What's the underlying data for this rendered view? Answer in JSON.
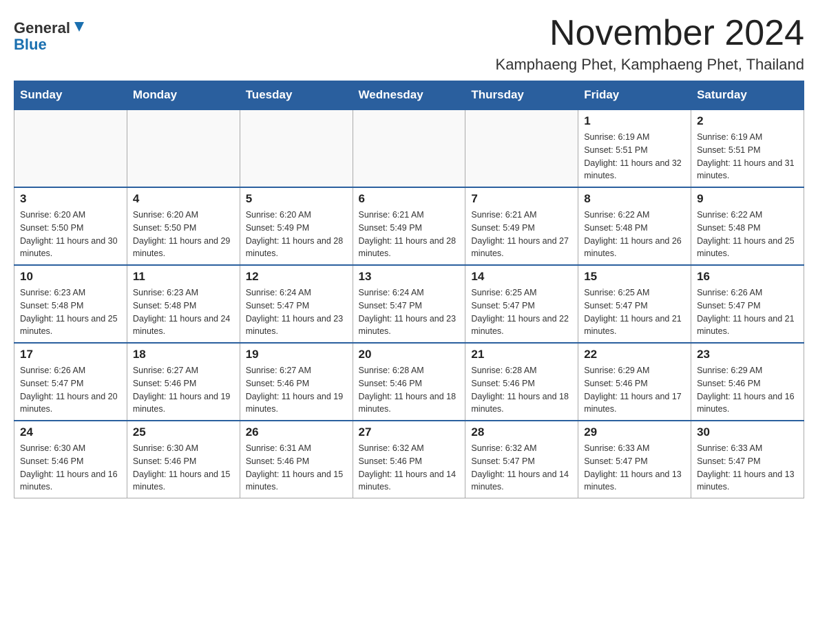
{
  "header": {
    "logo_general": "General",
    "logo_blue": "Blue",
    "month_year": "November 2024",
    "location": "Kamphaeng Phet, Kamphaeng Phet, Thailand"
  },
  "days_of_week": [
    "Sunday",
    "Monday",
    "Tuesday",
    "Wednesday",
    "Thursday",
    "Friday",
    "Saturday"
  ],
  "weeks": [
    [
      {
        "day": "",
        "info": ""
      },
      {
        "day": "",
        "info": ""
      },
      {
        "day": "",
        "info": ""
      },
      {
        "day": "",
        "info": ""
      },
      {
        "day": "",
        "info": ""
      },
      {
        "day": "1",
        "info": "Sunrise: 6:19 AM\nSunset: 5:51 PM\nDaylight: 11 hours and 32 minutes."
      },
      {
        "day": "2",
        "info": "Sunrise: 6:19 AM\nSunset: 5:51 PM\nDaylight: 11 hours and 31 minutes."
      }
    ],
    [
      {
        "day": "3",
        "info": "Sunrise: 6:20 AM\nSunset: 5:50 PM\nDaylight: 11 hours and 30 minutes."
      },
      {
        "day": "4",
        "info": "Sunrise: 6:20 AM\nSunset: 5:50 PM\nDaylight: 11 hours and 29 minutes."
      },
      {
        "day": "5",
        "info": "Sunrise: 6:20 AM\nSunset: 5:49 PM\nDaylight: 11 hours and 28 minutes."
      },
      {
        "day": "6",
        "info": "Sunrise: 6:21 AM\nSunset: 5:49 PM\nDaylight: 11 hours and 28 minutes."
      },
      {
        "day": "7",
        "info": "Sunrise: 6:21 AM\nSunset: 5:49 PM\nDaylight: 11 hours and 27 minutes."
      },
      {
        "day": "8",
        "info": "Sunrise: 6:22 AM\nSunset: 5:48 PM\nDaylight: 11 hours and 26 minutes."
      },
      {
        "day": "9",
        "info": "Sunrise: 6:22 AM\nSunset: 5:48 PM\nDaylight: 11 hours and 25 minutes."
      }
    ],
    [
      {
        "day": "10",
        "info": "Sunrise: 6:23 AM\nSunset: 5:48 PM\nDaylight: 11 hours and 25 minutes."
      },
      {
        "day": "11",
        "info": "Sunrise: 6:23 AM\nSunset: 5:48 PM\nDaylight: 11 hours and 24 minutes."
      },
      {
        "day": "12",
        "info": "Sunrise: 6:24 AM\nSunset: 5:47 PM\nDaylight: 11 hours and 23 minutes."
      },
      {
        "day": "13",
        "info": "Sunrise: 6:24 AM\nSunset: 5:47 PM\nDaylight: 11 hours and 23 minutes."
      },
      {
        "day": "14",
        "info": "Sunrise: 6:25 AM\nSunset: 5:47 PM\nDaylight: 11 hours and 22 minutes."
      },
      {
        "day": "15",
        "info": "Sunrise: 6:25 AM\nSunset: 5:47 PM\nDaylight: 11 hours and 21 minutes."
      },
      {
        "day": "16",
        "info": "Sunrise: 6:26 AM\nSunset: 5:47 PM\nDaylight: 11 hours and 21 minutes."
      }
    ],
    [
      {
        "day": "17",
        "info": "Sunrise: 6:26 AM\nSunset: 5:47 PM\nDaylight: 11 hours and 20 minutes."
      },
      {
        "day": "18",
        "info": "Sunrise: 6:27 AM\nSunset: 5:46 PM\nDaylight: 11 hours and 19 minutes."
      },
      {
        "day": "19",
        "info": "Sunrise: 6:27 AM\nSunset: 5:46 PM\nDaylight: 11 hours and 19 minutes."
      },
      {
        "day": "20",
        "info": "Sunrise: 6:28 AM\nSunset: 5:46 PM\nDaylight: 11 hours and 18 minutes."
      },
      {
        "day": "21",
        "info": "Sunrise: 6:28 AM\nSunset: 5:46 PM\nDaylight: 11 hours and 18 minutes."
      },
      {
        "day": "22",
        "info": "Sunrise: 6:29 AM\nSunset: 5:46 PM\nDaylight: 11 hours and 17 minutes."
      },
      {
        "day": "23",
        "info": "Sunrise: 6:29 AM\nSunset: 5:46 PM\nDaylight: 11 hours and 16 minutes."
      }
    ],
    [
      {
        "day": "24",
        "info": "Sunrise: 6:30 AM\nSunset: 5:46 PM\nDaylight: 11 hours and 16 minutes."
      },
      {
        "day": "25",
        "info": "Sunrise: 6:30 AM\nSunset: 5:46 PM\nDaylight: 11 hours and 15 minutes."
      },
      {
        "day": "26",
        "info": "Sunrise: 6:31 AM\nSunset: 5:46 PM\nDaylight: 11 hours and 15 minutes."
      },
      {
        "day": "27",
        "info": "Sunrise: 6:32 AM\nSunset: 5:46 PM\nDaylight: 11 hours and 14 minutes."
      },
      {
        "day": "28",
        "info": "Sunrise: 6:32 AM\nSunset: 5:47 PM\nDaylight: 11 hours and 14 minutes."
      },
      {
        "day": "29",
        "info": "Sunrise: 6:33 AM\nSunset: 5:47 PM\nDaylight: 11 hours and 13 minutes."
      },
      {
        "day": "30",
        "info": "Sunrise: 6:33 AM\nSunset: 5:47 PM\nDaylight: 11 hours and 13 minutes."
      }
    ]
  ]
}
